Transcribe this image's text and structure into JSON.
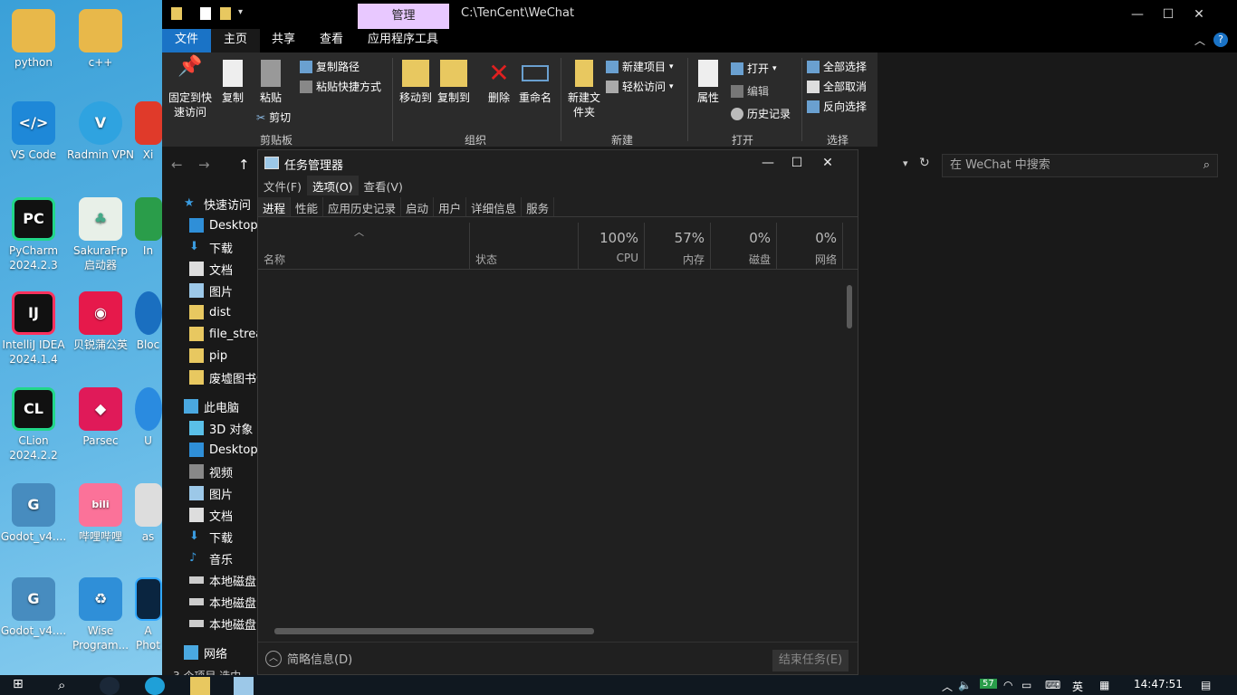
{
  "desktop": {
    "icons": [
      {
        "label": "python"
      },
      {
        "label": "c++"
      },
      {
        "label": "VS Code"
      },
      {
        "label": "Radmin VPN"
      },
      {
        "label": "Xi"
      },
      {
        "label": "PyCharm 2024.2.3"
      },
      {
        "label": "SakuraFrp 启动器"
      },
      {
        "label": "In"
      },
      {
        "label": "IntelliJ IDEA 2024.1.4"
      },
      {
        "label": "贝锐蒲公英"
      },
      {
        "label": "Bloc"
      },
      {
        "label": "CLion 2024.2.2"
      },
      {
        "label": "Parsec"
      },
      {
        "label": "U"
      },
      {
        "label": "Godot_v4...."
      },
      {
        "label": "哔哩哔哩"
      },
      {
        "label": "as"
      },
      {
        "label": "Godot_v4...."
      },
      {
        "label": "Wise Program..."
      },
      {
        "label": "A Phot"
      }
    ]
  },
  "explorer": {
    "manage_tab": "管理",
    "path": "C:\\TenCent\\WeChat",
    "ribbon_tabs": {
      "file": "文件",
      "home": "主页",
      "share": "共享",
      "view": "查看",
      "app_tools": "应用程序工具"
    },
    "ribbon": {
      "pin": "固定到快速访问",
      "copy": "复制",
      "paste": "粘贴",
      "copy_path": "复制路径",
      "paste_shortcut": "粘贴快捷方式",
      "cut": "剪切",
      "clipboard_group": "剪贴板",
      "move_to": "移动到",
      "copy_to": "复制到",
      "delete": "删除",
      "rename": "重命名",
      "organize_group": "组织",
      "new_folder": "新建文件夹",
      "new_item": "新建项目",
      "easy_access": "轻松访问",
      "new_group": "新建",
      "properties": "属性",
      "open": "打开",
      "edit": "编辑",
      "history": "历史记录",
      "open_group": "打开",
      "select_all": "全部选择",
      "select_none": "全部取消",
      "invert_selection": "反向选择",
      "select_group": "选择"
    },
    "search_placeholder": "在 WeChat 中搜索",
    "nav": {
      "quick_access": "快速访问",
      "desktop": "Desktop",
      "downloads": "下载",
      "documents": "文档",
      "pictures": "图片",
      "dist": "dist",
      "file_stream": "file_strea",
      "pip": "pip",
      "ruins": "废墟图书馆",
      "this_pc": "此电脑",
      "objects3d": "3D 对象",
      "desktop2": "Desktop",
      "videos": "视频",
      "pictures2": "图片",
      "documents2": "文档",
      "downloads2": "下载",
      "music": "音乐",
      "disk1": "本地磁盘",
      "disk2": "本地磁盘",
      "disk3": "本地磁盘",
      "network": "网络"
    },
    "status": "3 个项目   选中"
  },
  "taskmgr": {
    "title": "任务管理器",
    "menu": [
      "文件(F)",
      "选项(O)",
      "查看(V)"
    ],
    "tabs": [
      "进程",
      "性能",
      "应用历史记录",
      "启动",
      "用户",
      "详细信息",
      "服务"
    ],
    "columns": {
      "name": "名称",
      "status": "状态",
      "cpu_pct": "100%",
      "cpu": "CPU",
      "mem_pct": "57%",
      "mem": "内存",
      "disk_pct": "0%",
      "disk": "磁盘",
      "net_pct": "0%",
      "net": "网络"
    },
    "fewer_details": "简略信息(D)",
    "end_task": "结束任务(E)"
  },
  "taskbar": {
    "time": "14:47:51",
    "ime": "英",
    "badge": "57"
  },
  "colors": {
    "accent": "#1a73c6",
    "manage_tab": "#e8c8ff",
    "window_bg": "#191919",
    "taskmgr_bg": "#202020"
  }
}
